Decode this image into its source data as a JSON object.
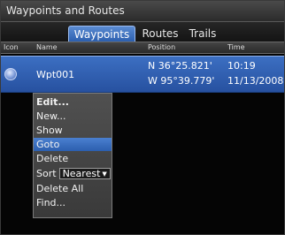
{
  "window": {
    "title": "Waypoints and Routes"
  },
  "tabs": [
    {
      "label": "Waypoints",
      "active": true
    },
    {
      "label": "Routes",
      "active": false
    },
    {
      "label": "Trails",
      "active": false
    }
  ],
  "columns": [
    "Icon",
    "Name",
    "Position",
    "Time"
  ],
  "waypoints": [
    {
      "name": "Wpt001",
      "lat": "N  36°25.821'",
      "lon": "W  95°39.779'",
      "time": "10:19",
      "date": "11/13/2008",
      "icon": "circle-waypoint-icon"
    }
  ],
  "context_menu": {
    "items": [
      {
        "label": "Edit...",
        "bold": true
      },
      {
        "label": "New..."
      },
      {
        "label": "Show"
      },
      {
        "label": "Goto",
        "selected": true
      },
      {
        "label": "Delete"
      },
      {
        "label": "Sort",
        "value": "Nearest"
      },
      {
        "label": "Delete All"
      },
      {
        "label": "Find..."
      }
    ]
  },
  "colors": {
    "accent": "#2f62b5",
    "row_highlight": "#3c6fc2",
    "menu_bg": "#474747"
  }
}
